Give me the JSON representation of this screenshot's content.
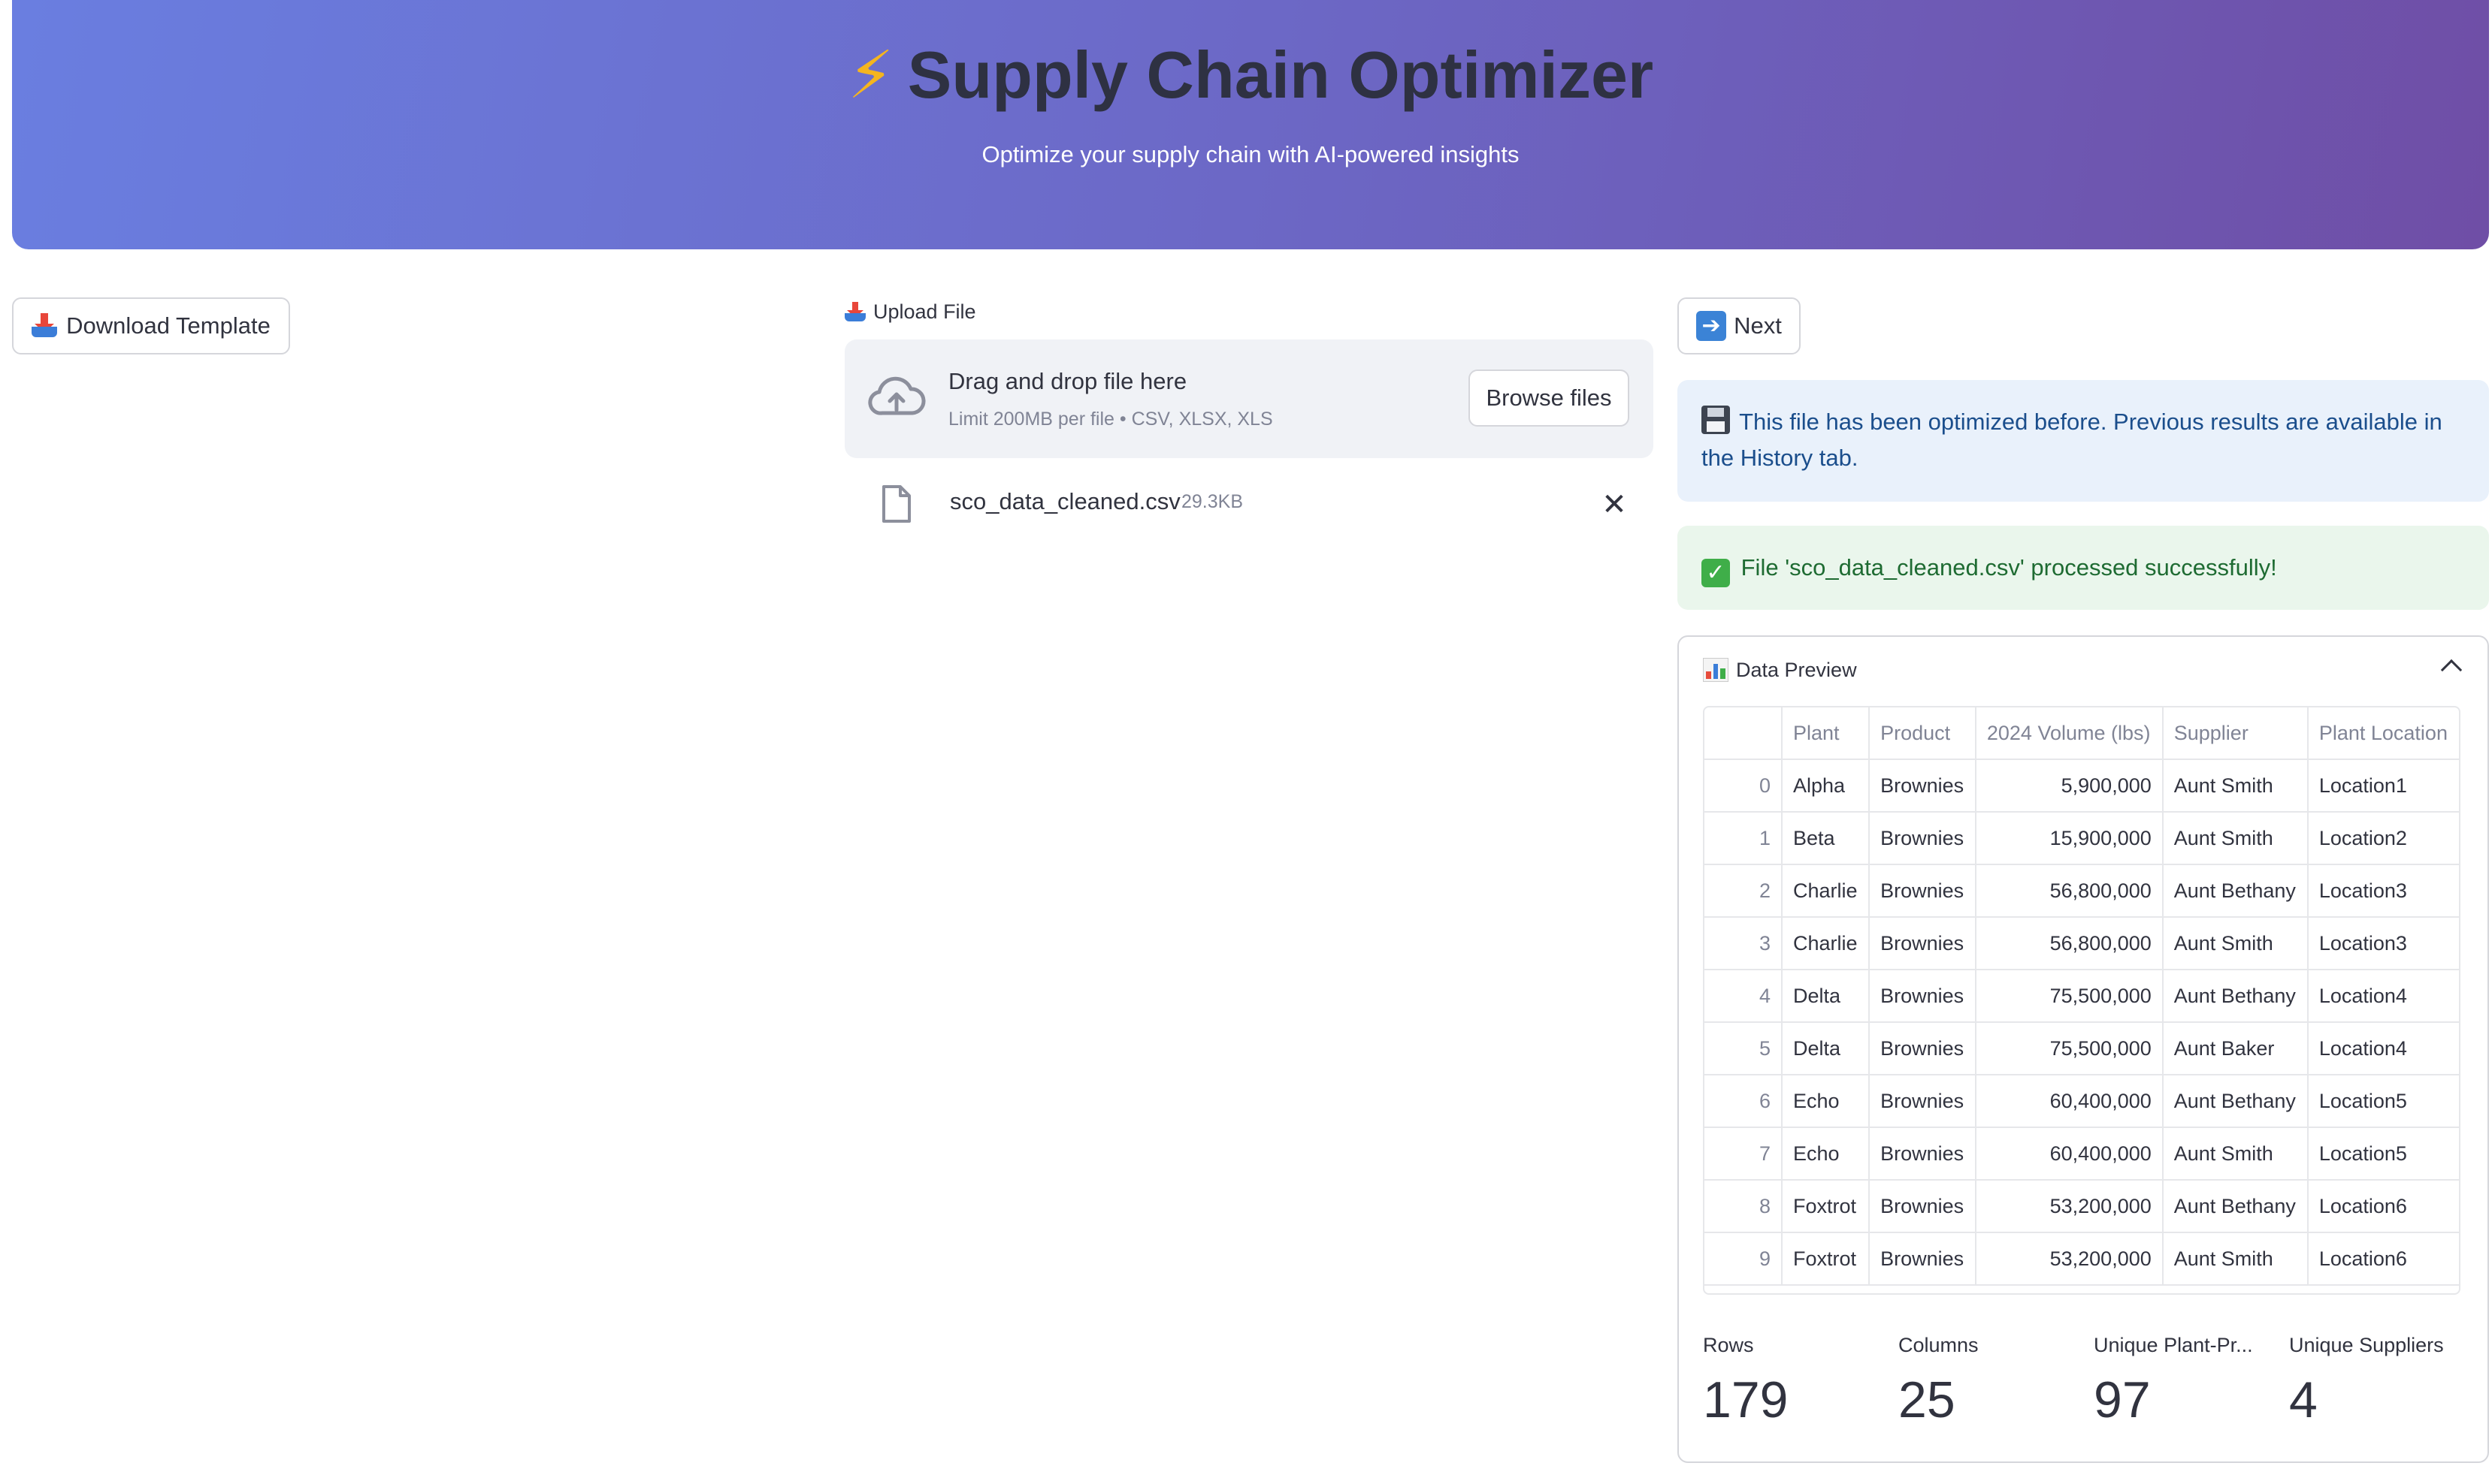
{
  "header": {
    "title": "Supply Chain Optimizer",
    "subtitle": "Optimize your supply chain with AI-powered insights",
    "title_icon": "lightning-icon"
  },
  "toolbar": {
    "download_template_label": "Download Template",
    "next_label": "Next"
  },
  "upload": {
    "label": "Upload File",
    "drop_title": "Drag and drop file here",
    "drop_limit": "Limit 200MB per file • CSV, XLSX, XLS",
    "browse_label": "Browse files",
    "file_name": "sco_data_cleaned.csv",
    "file_size": "29.3KB"
  },
  "alerts": {
    "info_text": "This file has been optimized before. Previous results are available in the History tab.",
    "success_text": "File 'sco_data_cleaned.csv' processed successfully!"
  },
  "preview": {
    "title": "Data Preview",
    "columns": [
      "",
      "Plant",
      "Product",
      "2024 Volume (lbs)",
      "Supplier",
      "Plant Location"
    ],
    "rows": [
      [
        "0",
        "Alpha",
        "Brownies",
        "5,900,000",
        "Aunt Smith",
        "Location1"
      ],
      [
        "1",
        "Beta",
        "Brownies",
        "15,900,000",
        "Aunt Smith",
        "Location2"
      ],
      [
        "2",
        "Charlie",
        "Brownies",
        "56,800,000",
        "Aunt Bethany",
        "Location3"
      ],
      [
        "3",
        "Charlie",
        "Brownies",
        "56,800,000",
        "Aunt Smith",
        "Location3"
      ],
      [
        "4",
        "Delta",
        "Brownies",
        "75,500,000",
        "Aunt Bethany",
        "Location4"
      ],
      [
        "5",
        "Delta",
        "Brownies",
        "75,500,000",
        "Aunt Baker",
        "Location4"
      ],
      [
        "6",
        "Echo",
        "Brownies",
        "60,400,000",
        "Aunt Bethany",
        "Location5"
      ],
      [
        "7",
        "Echo",
        "Brownies",
        "60,400,000",
        "Aunt Smith",
        "Location5"
      ],
      [
        "8",
        "Foxtrot",
        "Brownies",
        "53,200,000",
        "Aunt Bethany",
        "Location6"
      ],
      [
        "9",
        "Foxtrot",
        "Brownies",
        "53,200,000",
        "Aunt Smith",
        "Location6"
      ]
    ]
  },
  "metrics": [
    {
      "label": "Rows",
      "value": "179"
    },
    {
      "label": "Columns",
      "value": "25"
    },
    {
      "label": "Unique Plant-Pr...",
      "value": "97"
    },
    {
      "label": "Unique Suppliers",
      "value": "4"
    }
  ],
  "colors": {
    "banner_start": "#6a7ee0",
    "banner_end": "#6f4ea6",
    "info_bg": "#e9f1fb",
    "success_bg": "#eaf6ec"
  }
}
